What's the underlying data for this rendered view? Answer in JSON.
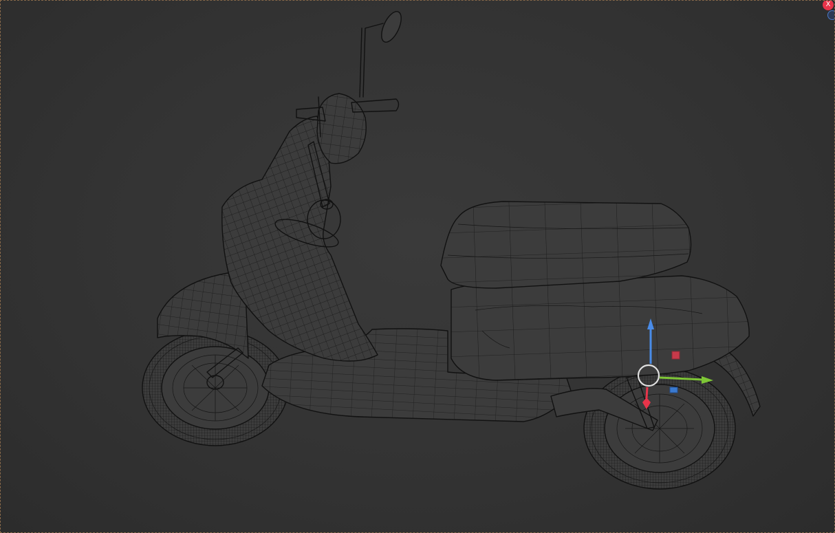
{
  "viewport": {
    "mode": "wireframe",
    "object": "scooter"
  },
  "window_controls": {
    "close_label": "X"
  },
  "gizmo": {
    "type": "translate",
    "axis_colors": {
      "x": "#e8344a",
      "y": "#7ec636",
      "z": "#4a8ce8"
    }
  },
  "colors": {
    "background": "#333333",
    "wire": "#111111",
    "border": "#8a6a4a"
  }
}
